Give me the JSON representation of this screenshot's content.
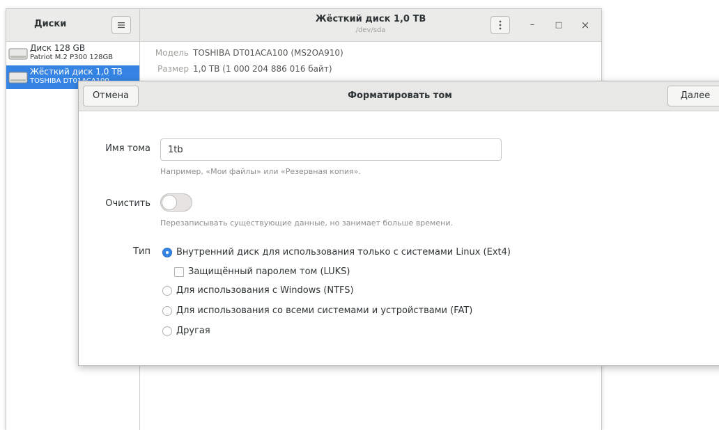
{
  "sidebar": {
    "title": "Диски",
    "drives": [
      {
        "name": "Диск 128 GB",
        "desc": "Patriot M.2 P300 128GB",
        "selected": false
      },
      {
        "name": "Жёсткий диск 1,0 TB",
        "desc": "TOSHIBA DT01ACA100",
        "selected": true
      }
    ]
  },
  "header": {
    "title": "Жёсткий диск 1,0 TB",
    "subtitle": "/dev/sda"
  },
  "details": [
    {
      "key": "Модель",
      "value": "TOSHIBA DT01ACA100 (MS2OA910)"
    },
    {
      "key": "Размер",
      "value": "1,0 TB (1 000 204 886 016 байт)"
    }
  ],
  "window_controls": {
    "minimize": "–",
    "maximize": "□",
    "close": "×"
  },
  "dialog": {
    "title": "Форматировать том",
    "cancel_label": "Отмена",
    "next_label": "Далее",
    "volume_name_label": "Имя тома",
    "volume_name_value": "1tb",
    "volume_name_hint": "Например, «Мои файлы» или «Резервная копия».",
    "erase_label": "Очистить",
    "erase_on": false,
    "erase_hint": "Перезаписывать существующие данные, но занимает больше времени.",
    "type_label": "Тип",
    "options": {
      "ext4": "Внутренний диск для использования только с системами Linux (Ext4)",
      "luks": "Защищённый паролем том (LUKS)",
      "ntfs": "Для использования с Windows (NTFS)",
      "fat": "Для использования со всеми системами и устройствами (FAT)",
      "other": "Другая"
    },
    "selected_type": "ext4",
    "luks_checked": false
  },
  "colors": {
    "accent": "#3584e4",
    "header_bg": "#ebebea"
  }
}
